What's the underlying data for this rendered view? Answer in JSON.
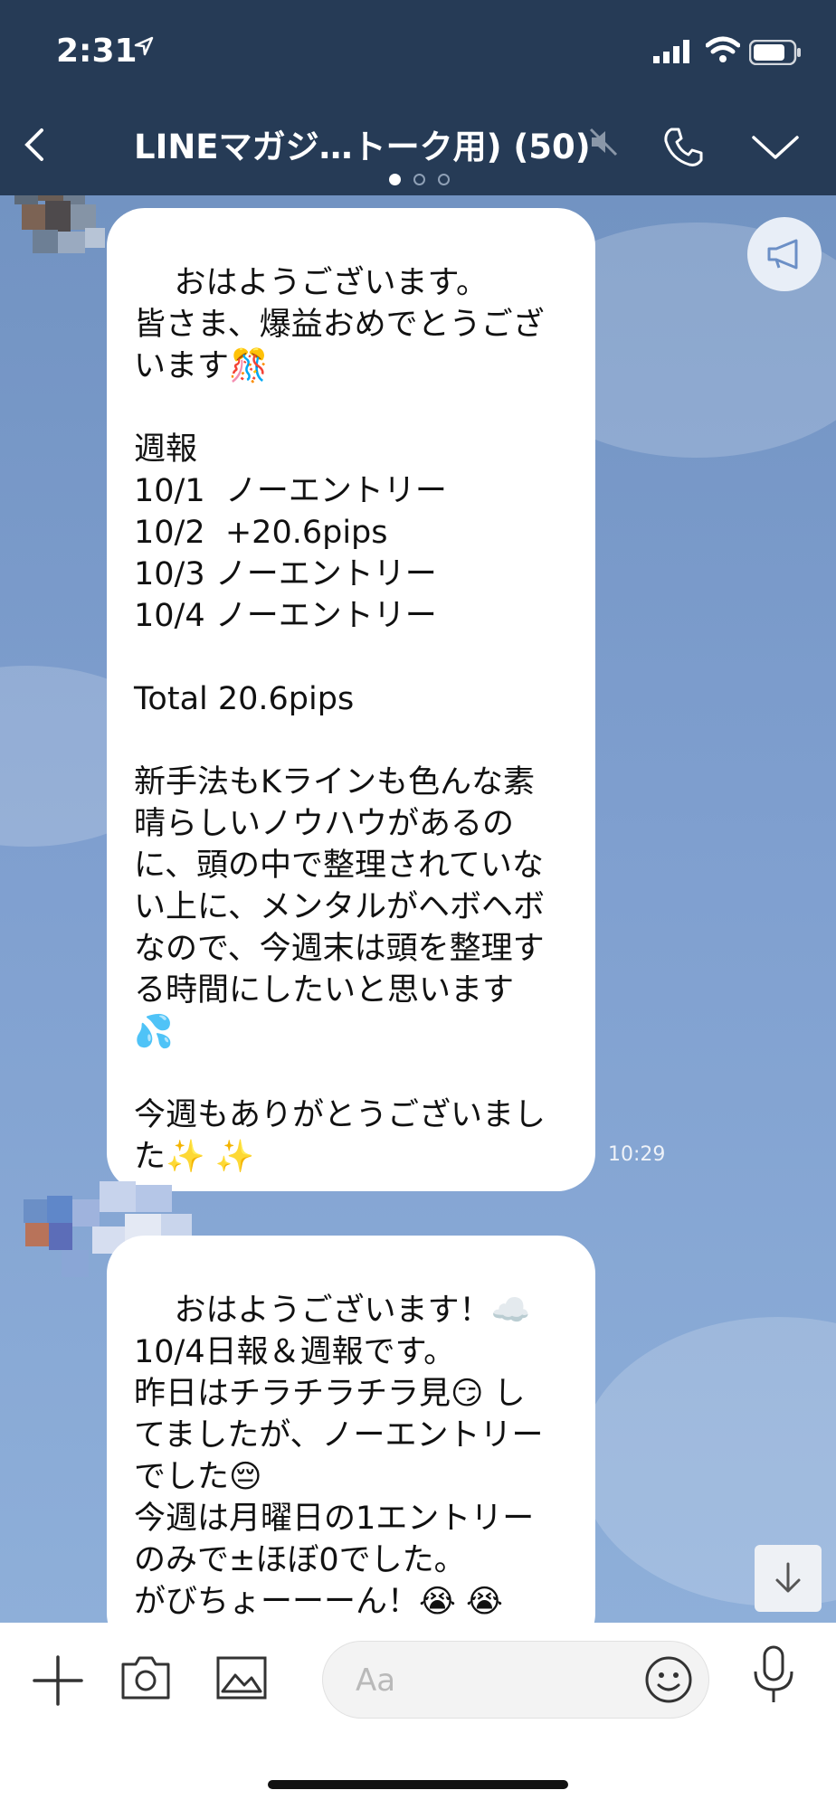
{
  "status_bar": {
    "time": "2:31"
  },
  "header": {
    "title": "LINEマガジ…トーク用) (50)"
  },
  "messages": [
    {
      "text": "おはようございます。\n皆さま、爆益おめでとうござ\nいます🎊\n\n週報\n10/1  ノーエントリー\n10/2  +20.6pips\n10/3 ノーエントリー\n10/4 ノーエントリー\n\nTotal 20.6pips\n\n新手法もKラインも色んな素\n晴らしいノウハウがあるの\nに、頭の中で整理されていな\nい上に、メンタルがヘボヘボ\nなので、今週末は頭を整理す\nる時間にしたいと思います\n💦\n\n今週もありがとうございまし\nた✨ ✨",
      "time": "10:29"
    },
    {
      "text": "おはようございます！☁️\n10/4日報＆週報です。\n昨日はチラチラチラ見😏 し\nてましたが、ノーエントリー\nでした😔\n今週は月曜日の1エントリー\nのみで±ほぼ0でした。\nがびちょーーーん！😭 😭"
    }
  ],
  "input": {
    "placeholder": "Aa"
  },
  "colors": {
    "header_bg": "#263b56",
    "chat_bg": "#7b9bc9",
    "bubble": "#ffffff"
  }
}
